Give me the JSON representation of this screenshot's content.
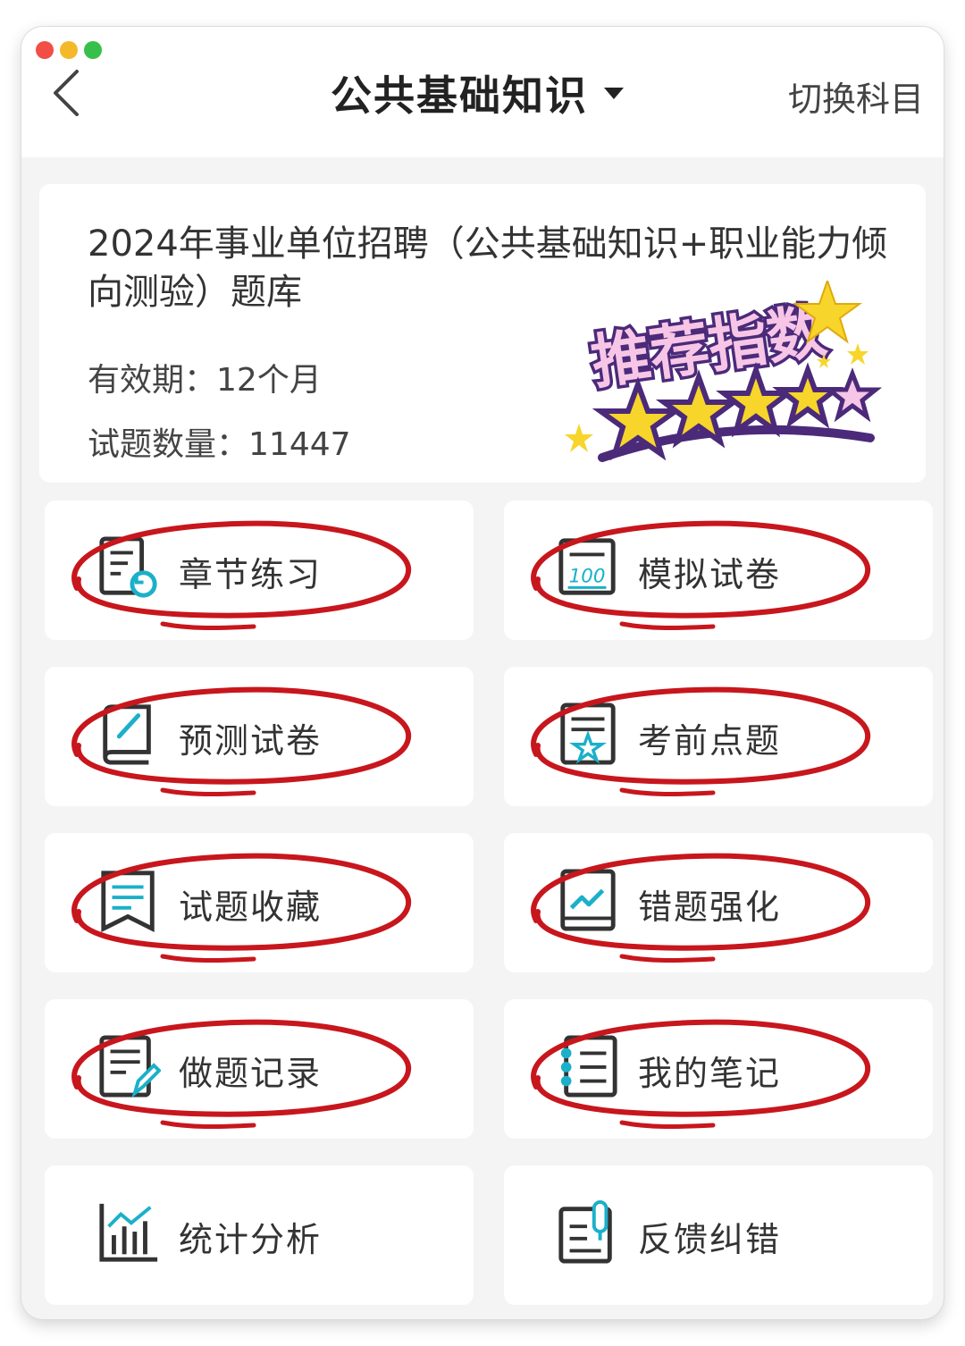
{
  "header": {
    "title": "公共基础知识",
    "switch_label": "切换科目"
  },
  "bank": {
    "title": "2024年事业单位招聘（公共基础知识+职业能力倾向测验）题库",
    "validity_label": "有效期：",
    "validity_value": "12个月",
    "count_label": "试题数量：",
    "count_value": "11447",
    "badge_text": "推荐指数",
    "badge_rating": 4.5
  },
  "menu": [
    {
      "label": "章节练习",
      "icon": "chapter-practice-icon",
      "circled": true
    },
    {
      "label": "模拟试卷",
      "icon": "mock-exam-icon",
      "circled": true
    },
    {
      "label": "预测试卷",
      "icon": "forecast-exam-icon",
      "circled": true
    },
    {
      "label": "考前点题",
      "icon": "star-doc-icon",
      "circled": true
    },
    {
      "label": "试题收藏",
      "icon": "bookmark-icon",
      "circled": true
    },
    {
      "label": "错题强化",
      "icon": "trend-icon",
      "circled": true
    },
    {
      "label": "做题记录",
      "icon": "record-edit-icon",
      "circled": true
    },
    {
      "label": "我的笔记",
      "icon": "notebook-icon",
      "circled": true
    },
    {
      "label": "统计分析",
      "icon": "bar-chart-icon",
      "circled": false
    },
    {
      "label": "反馈纠错",
      "icon": "feedback-icon",
      "circled": false
    }
  ],
  "colors": {
    "accent": "#1bb0c9",
    "annotation_red": "#c8161d",
    "badge_purple": "#4b2a7a",
    "badge_pink": "#f7c6e6",
    "star_yellow": "#f7d52a"
  }
}
